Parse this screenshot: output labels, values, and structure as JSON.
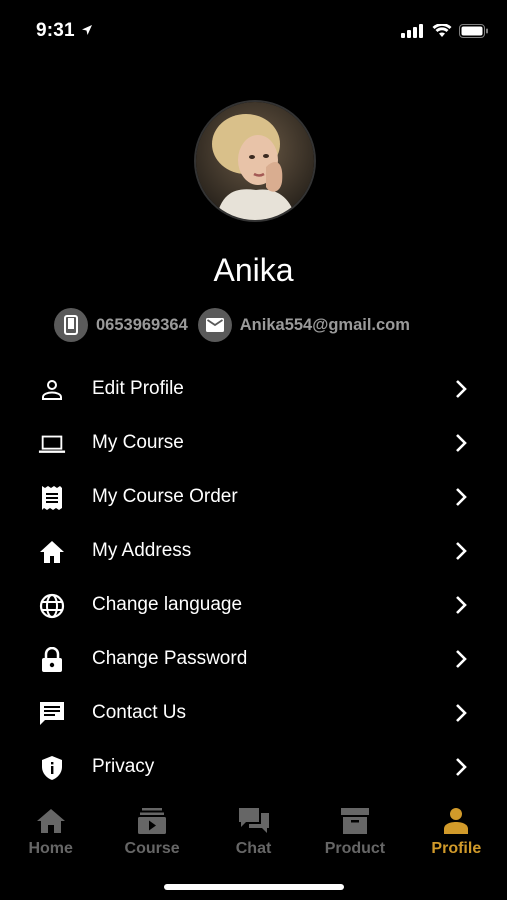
{
  "status_bar": {
    "time": "9:31"
  },
  "profile": {
    "name": "Anika",
    "phone": "0653969364",
    "email": "Anika554@gmail.com"
  },
  "menu": [
    {
      "label": "Edit Profile",
      "icon": "person-icon"
    },
    {
      "label": "My Course",
      "icon": "laptop-icon"
    },
    {
      "label": "My Course Order",
      "icon": "receipt-icon"
    },
    {
      "label": "My Address",
      "icon": "home-icon"
    },
    {
      "label": "Change language",
      "icon": "globe-icon"
    },
    {
      "label": "Change Password",
      "icon": "lock-icon"
    },
    {
      "label": "Contact Us",
      "icon": "chat-icon"
    },
    {
      "label": "Privacy",
      "icon": "shield-icon"
    }
  ],
  "tabs": [
    {
      "label": "Home",
      "icon": "home-icon",
      "active": false
    },
    {
      "label": "Course",
      "icon": "course-icon",
      "active": false
    },
    {
      "label": "Chat",
      "icon": "chat-bubbles-icon",
      "active": false
    },
    {
      "label": "Product",
      "icon": "box-icon",
      "active": false
    },
    {
      "label": "Profile",
      "icon": "profile-icon",
      "active": true
    }
  ],
  "colors": {
    "background": "#000000",
    "accent": "#d19a2a",
    "inactive": "#666666",
    "muted_text": "#9a9a9a"
  }
}
